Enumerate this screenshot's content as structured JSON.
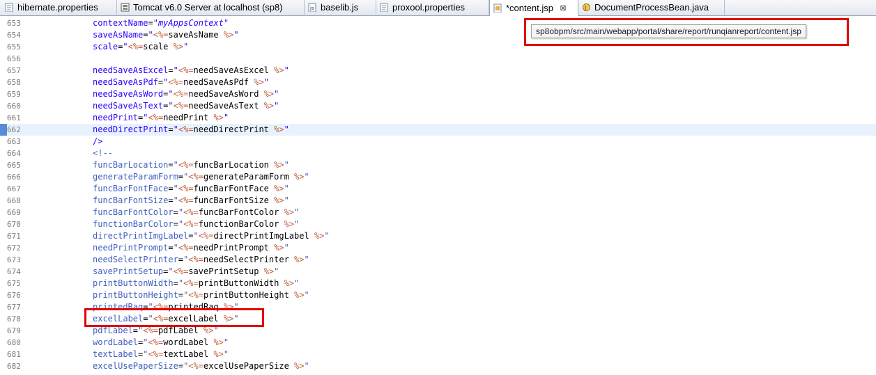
{
  "tabs": [
    {
      "label": "hibernate.properties",
      "icon": "properties-file-icon",
      "active": false
    },
    {
      "label": "Tomcat v6.0 Server at localhost (sp8)",
      "icon": "server-icon",
      "active": false
    },
    {
      "label": "baselib.js",
      "icon": "js-file-icon",
      "active": false
    },
    {
      "label": "proxool.properties",
      "icon": "properties-file-icon",
      "active": false
    },
    {
      "label": "*content.jsp",
      "icon": "jsp-file-icon",
      "active": true,
      "close": "⊠"
    },
    {
      "label": "DocumentProcessBean.java",
      "icon": "java-file-icon",
      "active": false
    }
  ],
  "tooltip": {
    "text": "sp8obpm/src/main/webapp/portal/share/report/runqianreport/content.jsp"
  },
  "lines": [
    {
      "n": "653",
      "a": "contextName",
      "v": "myAppsContext",
      "kind": "italic"
    },
    {
      "n": "654",
      "a": "saveAsName",
      "v": "saveAsName",
      "kind": "jsp"
    },
    {
      "n": "655",
      "a": "scale",
      "v": "scale",
      "kind": "jsp"
    },
    {
      "n": "656",
      "kind": "blank"
    },
    {
      "n": "657",
      "a": "needSaveAsExcel",
      "v": "needSaveAsExcel",
      "kind": "jsp"
    },
    {
      "n": "658",
      "a": "needSaveAsPdf",
      "v": "needSaveAsPdf",
      "kind": "jsp"
    },
    {
      "n": "659",
      "a": "needSaveAsWord",
      "v": "needSaveAsWord",
      "kind": "jsp"
    },
    {
      "n": "660",
      "a": "needSaveAsText",
      "v": "needSaveAsText",
      "kind": "jsp"
    },
    {
      "n": "661",
      "a": "needPrint",
      "v": "needPrint",
      "kind": "jsp"
    },
    {
      "n": "662",
      "a": "needDirectPrint",
      "v": "needDirectPrint",
      "kind": "jsp",
      "current": true
    },
    {
      "n": "663",
      "text": "/>",
      "kind": "tagend"
    },
    {
      "n": "664",
      "text": "<!--",
      "kind": "comment"
    },
    {
      "n": "665",
      "a": "funcBarLocation",
      "v": "funcBarLocation",
      "kind": "jspc"
    },
    {
      "n": "666",
      "a": "generateParamForm",
      "v": "generateParamForm",
      "kind": "jspc"
    },
    {
      "n": "667",
      "a": "funcBarFontFace",
      "v": "funcBarFontFace",
      "kind": "jspc"
    },
    {
      "n": "668",
      "a": "funcBarFontSize",
      "v": "funcBarFontSize",
      "kind": "jspc"
    },
    {
      "n": "669",
      "a": "funcBarFontColor",
      "v": "funcBarFontColor",
      "kind": "jspc"
    },
    {
      "n": "670",
      "a": "functionBarColor",
      "v": "functionBarColor",
      "kind": "jspc"
    },
    {
      "n": "671",
      "a": "directPrintImgLabel",
      "v": "directPrintImgLabel",
      "kind": "jspc"
    },
    {
      "n": "672",
      "a": "needPrintPrompt",
      "v": "needPrintPrompt",
      "kind": "jspc"
    },
    {
      "n": "673",
      "a": "needSelectPrinter",
      "v": "needSelectPrinter",
      "kind": "jspc"
    },
    {
      "n": "674",
      "a": "savePrintSetup",
      "v": "savePrintSetup",
      "kind": "jspc"
    },
    {
      "n": "675",
      "a": "printButtonWidth",
      "v": "printButtonWidth",
      "kind": "jspc"
    },
    {
      "n": "676",
      "a": "printButtonHeight",
      "v": "printButtonHeight",
      "kind": "jspc"
    },
    {
      "n": "677",
      "a": "printedRaq",
      "v": "printedRaq",
      "kind": "jspc"
    },
    {
      "n": "678",
      "a": "excelLabel",
      "v": "excelLabel",
      "kind": "jspc"
    },
    {
      "n": "679",
      "a": "pdfLabel",
      "v": "pdfLabel",
      "kind": "jspc"
    },
    {
      "n": "680",
      "a": "wordLabel",
      "v": "wordLabel",
      "kind": "jspc"
    },
    {
      "n": "681",
      "a": "textLabel",
      "v": "textLabel",
      "kind": "jspc"
    },
    {
      "n": "682",
      "a": "excelUsePaperSize",
      "v": "excelUsePaperSize",
      "kind": "jspc"
    }
  ],
  "colors": {
    "highlight": "#e00000",
    "current_line": "#e8f2fe",
    "attr": "#7f007f",
    "string": "#2a00ff",
    "jsp": "#bf5f3f",
    "comment": "#3f5fbf"
  }
}
